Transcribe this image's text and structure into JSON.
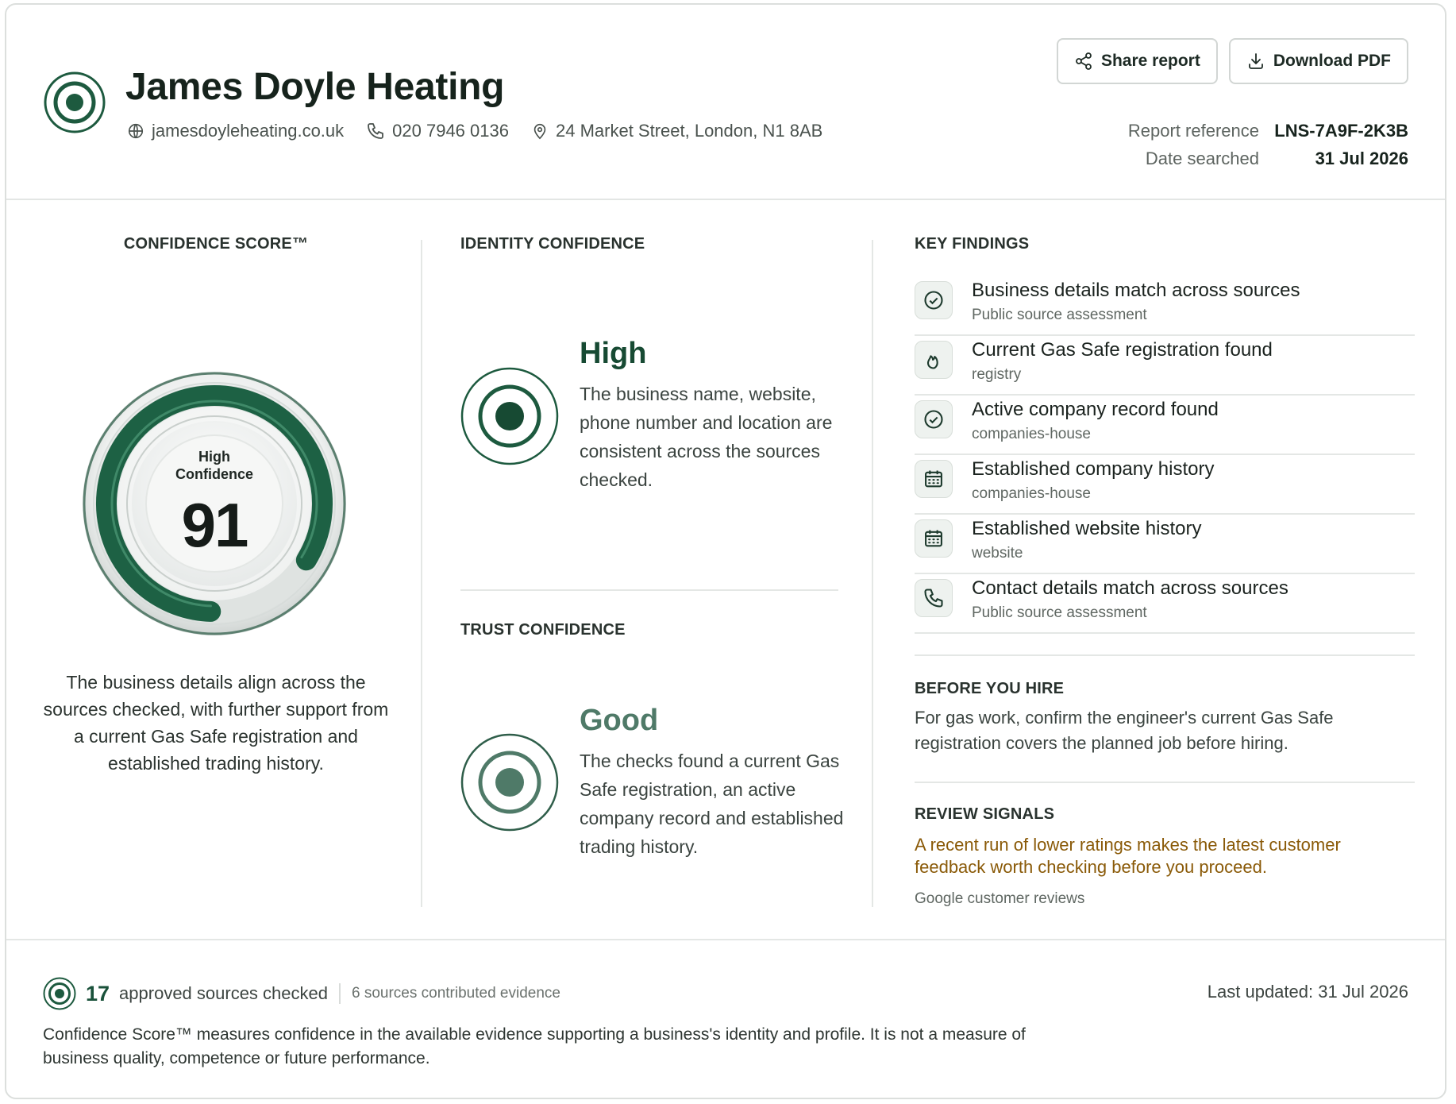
{
  "header": {
    "business_name": "James Doyle Heating",
    "website": "jamesdoyleheating.co.uk",
    "phone": "020 7946 0136",
    "address": "24 Market Street, London, N1 8AB",
    "share_label": "Share report",
    "download_label": "Download PDF",
    "report_reference_label": "Report reference",
    "report_reference_value": "LNS-7A9F-2K3B",
    "date_searched_label": "Date searched",
    "date_searched_value": "31 Jul 2026"
  },
  "confidence_score": {
    "title": "CONFIDENCE SCORE™",
    "label_line1": "High",
    "label_line2": "Confidence",
    "score": "91",
    "score_fraction": 0.91,
    "description": "The business details align across the sources checked, with further support from a current Gas Safe registration and established trading history."
  },
  "identity": {
    "title": "IDENTITY CONFIDENCE",
    "level": "High",
    "description": "The business name, website, phone number and location are consistent across the sources checked."
  },
  "trust": {
    "title": "TRUST CONFIDENCE",
    "level": "Good",
    "description": "The checks found a current Gas Safe registration, an active company record and established trading history."
  },
  "key_findings": {
    "title": "KEY FINDINGS",
    "items": [
      {
        "icon": "check-circle-icon",
        "title": "Business details match across sources",
        "source": "Public source assessment"
      },
      {
        "icon": "flame-icon",
        "title": "Current Gas Safe registration found",
        "source": "registry"
      },
      {
        "icon": "check-circle-icon",
        "title": "Active company record found",
        "source": "companies-house"
      },
      {
        "icon": "calendar-icon",
        "title": "Established company history",
        "source": "companies-house"
      },
      {
        "icon": "calendar-icon",
        "title": "Established website history",
        "source": "website"
      },
      {
        "icon": "phone-icon",
        "title": "Contact details match across sources",
        "source": "Public source assessment"
      }
    ]
  },
  "before_you_hire": {
    "title": "BEFORE YOU HIRE",
    "text": "For gas work, confirm the engineer's current Gas Safe registration covers the planned job before hiring."
  },
  "review_signals": {
    "title": "REVIEW SIGNALS",
    "text": "A recent run of lower ratings makes the latest customer feedback worth checking before you proceed.",
    "source": "Google customer reviews"
  },
  "footer": {
    "sources_count": "17",
    "sources_label": "approved sources checked",
    "contributed": "6 sources contributed evidence",
    "last_updated": "Last updated: 31 Jul 2026",
    "note": "Confidence Score™ measures confidence in the available evidence supporting a business's identity and profile. It is not a measure of business quality, competence or future performance."
  },
  "colors": {
    "brand_green": "#1d5a3f",
    "dark_green": "#174a33",
    "muted_green": "#4f7a68",
    "warning_amber": "#8a5a08"
  }
}
